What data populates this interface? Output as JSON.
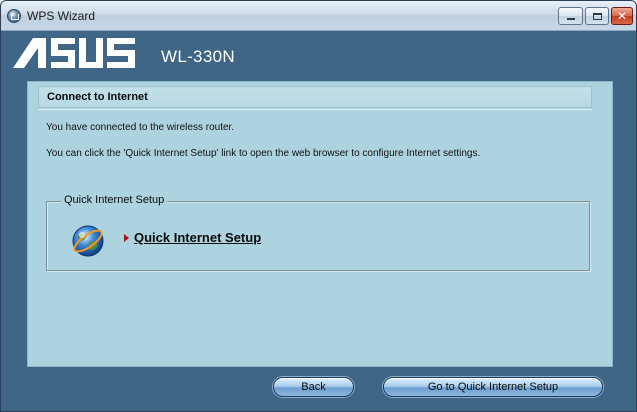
{
  "window": {
    "title": "WPS Wizard"
  },
  "brand": {
    "logo_text": "ASUS",
    "model": "WL-330N"
  },
  "section": {
    "title": "Connect to Internet",
    "message1": "You have connected to the wireless router.",
    "message2": "You can click the 'Quick Internet Setup' link to open the web browser to configure Internet settings."
  },
  "group": {
    "legend": "Quick Internet Setup",
    "link_label": "Quick Internet Setup"
  },
  "buttons": {
    "back": "Back",
    "go": "Go to Quick Internet Setup"
  },
  "colors": {
    "frame": "#3f6587",
    "panel": "#aed3e0",
    "link_arrow": "#a11515"
  },
  "icons": {
    "title": "router-app-icon",
    "globe": "globe-icon",
    "arrow": "play-arrow-icon"
  }
}
